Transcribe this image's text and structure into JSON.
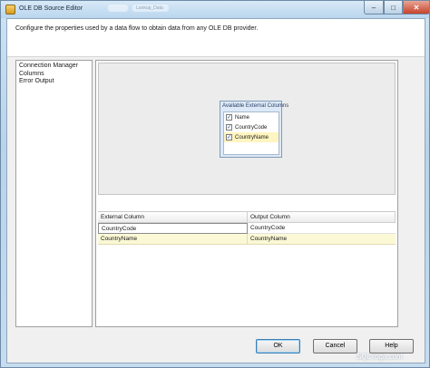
{
  "window": {
    "title": "OLE DB Source Editor",
    "ghost_tabs": [
      "",
      "Lookup_Data"
    ],
    "caption": {
      "minimize": "–",
      "maximize": "□",
      "close": "✕"
    }
  },
  "header": {
    "description": "Configure the properties used by a data flow to obtain data from any OLE DB provider."
  },
  "nav": {
    "items": [
      "Connection Manager",
      "Columns",
      "Error Output"
    ]
  },
  "available_columns": {
    "title": "Available External Columns",
    "items": [
      {
        "label": "Name",
        "checked": true,
        "check": "✓"
      },
      {
        "label": "CountryCode",
        "checked": true,
        "check": "✓"
      },
      {
        "label": "CountryName",
        "checked": true,
        "check": "✓"
      }
    ]
  },
  "mapping_grid": {
    "headers": [
      "External Column",
      "Output Column"
    ],
    "rows": [
      {
        "external": "CountryCode",
        "output": "CountryCode"
      },
      {
        "external": "CountryName",
        "output": "CountryName"
      }
    ]
  },
  "buttons": {
    "ok": "OK",
    "cancel": "Cancel",
    "help": "Help"
  },
  "watermark": "SQLYoga.com",
  "colors": {
    "selected_row": "#fbf8d6",
    "close_button": "#c6422a"
  }
}
